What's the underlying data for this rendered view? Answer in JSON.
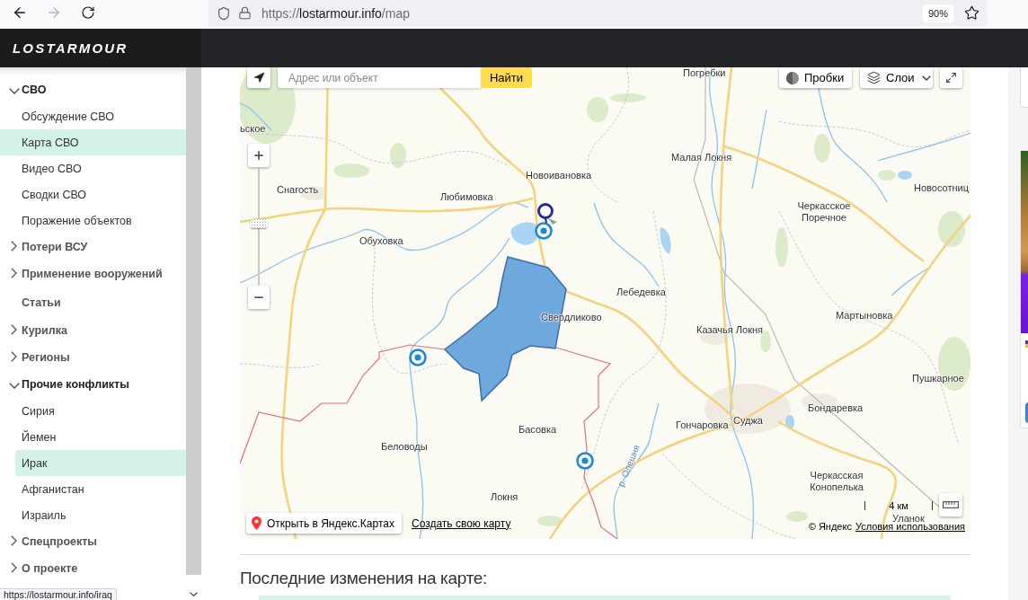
{
  "browser": {
    "nav_buttons": [
      {
        "kind": "back",
        "disabled": false
      },
      {
        "kind": "forward",
        "disabled": true
      },
      {
        "kind": "reload",
        "disabled": false
      }
    ],
    "url": {
      "scheme": "https://",
      "host": "lostarmour.info",
      "path": "/map"
    },
    "zoom": "90%"
  },
  "header": {
    "logo": "LOSTARMOUR"
  },
  "sidebar": {
    "items": [
      {
        "label": "СВО",
        "kind": "group",
        "expanded": true,
        "selected": false,
        "hovered": false,
        "children": [
          {
            "label": "Обсуждение СВО",
            "selected": false,
            "hovered": false
          },
          {
            "label": "Карта СВО",
            "selected": true,
            "hovered": false
          },
          {
            "label": "Видео СВО",
            "selected": false,
            "hovered": false
          },
          {
            "label": "Сводки СВО",
            "selected": false,
            "hovered": false
          },
          {
            "label": "Поражение объектов",
            "selected": false,
            "hovered": false
          }
        ]
      },
      {
        "label": "Потери ВСУ",
        "kind": "group",
        "expanded": false,
        "selected": false,
        "hovered": false
      },
      {
        "label": "Применение вооружений",
        "kind": "group",
        "expanded": false,
        "selected": false,
        "hovered": false
      },
      {
        "label": "Статьи",
        "kind": "link",
        "selected": false,
        "hovered": false
      },
      {
        "label": "Курилка",
        "kind": "group",
        "expanded": false,
        "selected": false,
        "hovered": false
      },
      {
        "label": "Регионы",
        "kind": "group",
        "expanded": false,
        "selected": false,
        "hovered": false
      },
      {
        "label": "Прочие конфликты",
        "kind": "group",
        "expanded": true,
        "selected": false,
        "hovered": false,
        "children": [
          {
            "label": "Сирия",
            "selected": false,
            "hovered": false
          },
          {
            "label": "Йемен",
            "selected": false,
            "hovered": false
          },
          {
            "label": "Ирак",
            "selected": false,
            "hovered": true
          },
          {
            "label": "Афганистан",
            "selected": false,
            "hovered": false
          },
          {
            "label": "Израиль",
            "selected": false,
            "hovered": false
          }
        ]
      },
      {
        "label": "Спецпроекты",
        "kind": "group",
        "expanded": false,
        "selected": false,
        "hovered": false
      },
      {
        "label": "О проекте",
        "kind": "group",
        "expanded": false,
        "selected": false,
        "hovered": false
      }
    ]
  },
  "map": {
    "search": {
      "placeholder": "Адрес или объект",
      "button": "Найти"
    },
    "traffic_button": "Пробки",
    "layers_button": "Слои",
    "zoom": {
      "level": 0.52
    },
    "places": [
      "Погребки",
      "ьское",
      "Малая Локня",
      "Новоивановка",
      "Снагость",
      "Любимовка",
      "Новосотниц",
      "Черкасское Поречное",
      "Обуховка",
      "Лебедевка",
      "Свердликово",
      "Мартыновка",
      "Казачья Локня",
      "Пушкарное",
      "Бондаревка",
      "Басовка",
      "Гончаровка",
      "Суджа",
      "Беловоды",
      "Черкасская Конопелька",
      "Локня",
      "Уланок"
    ],
    "river_label": "р. Олешня",
    "open_button": "Открыть в Яндекс.Картах",
    "create_link": "Создать свою карту",
    "scale": "4 км",
    "copyright": "© Яндекс",
    "terms_link": "Условия использования"
  },
  "section": {
    "heading": "Последние изменения на карте:"
  },
  "status_link": "https://lostarmour.info/iraq"
}
